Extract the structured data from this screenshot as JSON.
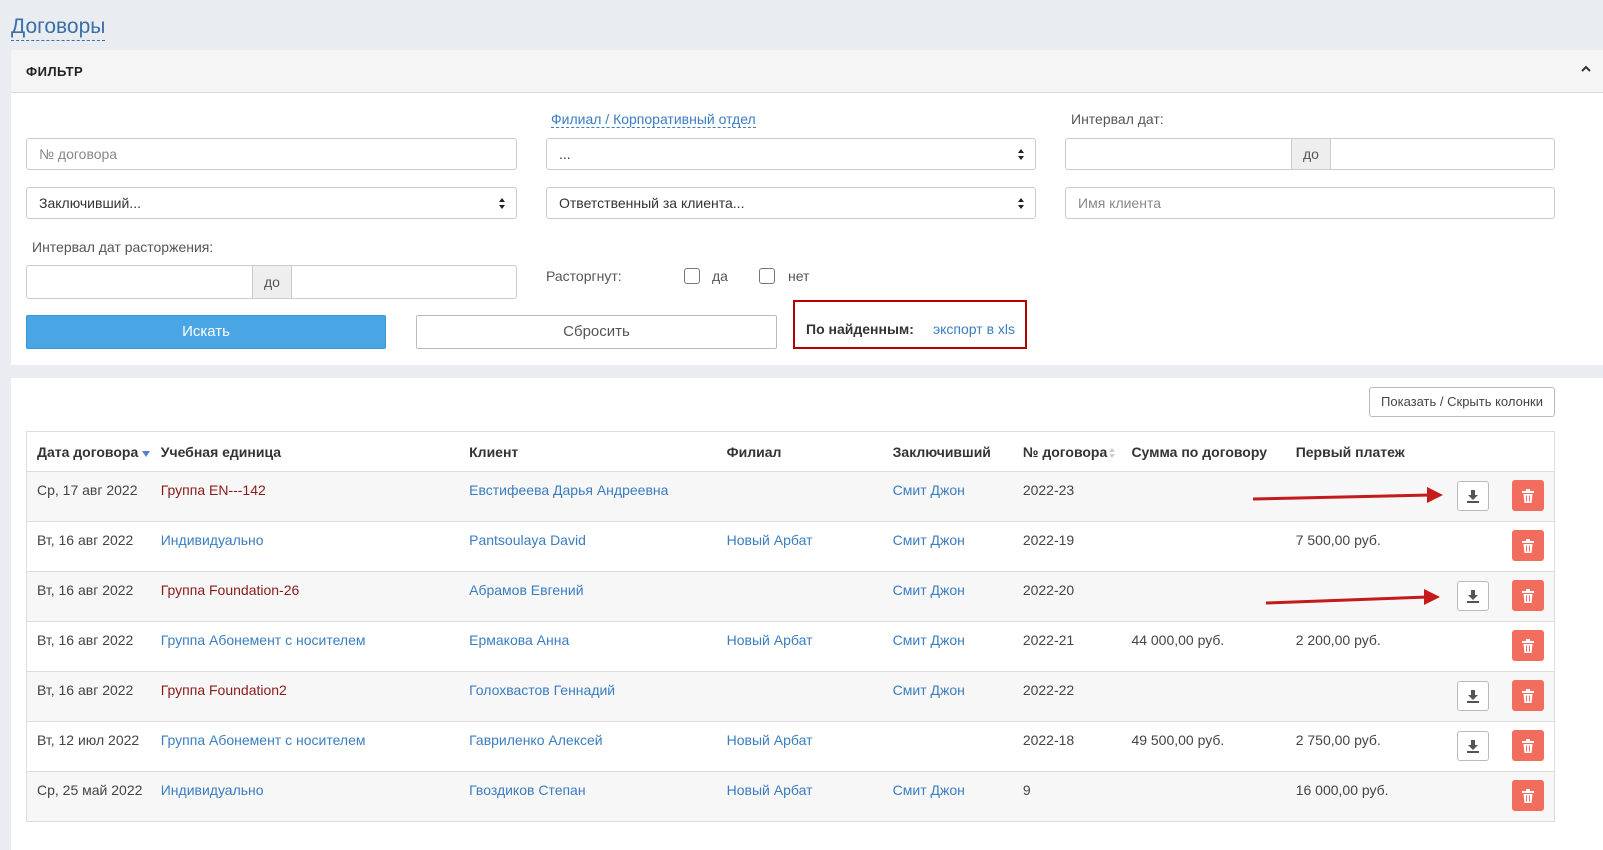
{
  "page_title": "Договоры",
  "filter": {
    "title": "ФИЛЬТР",
    "contract_no_placeholder": "№ договора",
    "branch_link": "Филиал / Корпоративный отдел",
    "branch_select_value": "...",
    "date_interval_label": "Интервал дат:",
    "date_to_label": "до",
    "concluded_select_value": "Заключивший...",
    "responsible_select_value": "Ответственный за клиента...",
    "client_name_placeholder": "Имя клиента",
    "termination_interval_label": "Интервал дат расторжения:",
    "termination_to_label": "до",
    "terminated_label": "Расторгнут:",
    "yes_label": "да",
    "no_label": "нет",
    "search_button": "Искать",
    "reset_button": "Сбросить",
    "export_label": "По найденным:",
    "export_link": "экспорт в xls"
  },
  "table": {
    "toggle_columns_button": "Показать / Скрыть колонки",
    "headers": [
      "Дата договора",
      "Учебная единица",
      "Клиент",
      "Филиал",
      "Заключивший",
      "№ договора",
      "Сумма по договору",
      "Первый платеж"
    ],
    "rows": [
      {
        "date": "Ср, 17 авг 2022",
        "unit": "Группа EN---142",
        "client": "Евстифеева Дарья Андреевна",
        "branch": "",
        "concluded": "Смит Джон",
        "number": "2022-23",
        "sum": "",
        "first_payment": "",
        "download": true
      },
      {
        "date": "Вт, 16 авг 2022",
        "unit": "Индивидуально",
        "client": "Pantsoulaya David",
        "branch": "Новый Арбат",
        "concluded": "Смит Джон",
        "number": "2022-19",
        "sum": "",
        "first_payment": "7 500,00 руб.",
        "download": false
      },
      {
        "date": "Вт, 16 авг 2022",
        "unit": "Группа Foundation-26",
        "client": "Абрамов Евгений",
        "branch": "",
        "concluded": "Смит Джон",
        "number": "2022-20",
        "sum": "",
        "first_payment": "",
        "download": true
      },
      {
        "date": "Вт, 16 авг 2022",
        "unit": "Группа Абонемент с носителем",
        "client": "Ермакова Анна",
        "branch": "Новый Арбат",
        "concluded": "Смит Джон",
        "number": "2022-21",
        "sum": "44 000,00 руб.",
        "first_payment": "2 200,00 руб.",
        "download": false
      },
      {
        "date": "Вт, 16 авг 2022",
        "unit": "Группа Foundation2",
        "client": "Голохвастов Геннадий",
        "branch": "",
        "concluded": "Смит Джон",
        "number": "2022-22",
        "sum": "",
        "first_payment": "",
        "download": true
      },
      {
        "date": "Вт, 12 июл 2022",
        "unit": "Группа Абонемент с носителем",
        "client": "Гавриленко Алексей",
        "branch": "Новый Арбат",
        "concluded": "",
        "number": "2022-18",
        "sum": "49 500,00 руб.",
        "first_payment": "2 750,00 руб.",
        "download": true
      },
      {
        "date": "Ср, 25 май 2022",
        "unit": "Индивидуально",
        "client": "Гвоздиков Степан",
        "branch": "Новый Арбат",
        "concluded": "Смит Джон",
        "number": "9",
        "sum": "",
        "first_payment": "16 000,00 руб.",
        "download": false
      }
    ]
  },
  "colors": {
    "link": "#3a7dc0",
    "group_link": "#8b1a1a",
    "primary_button": "#4aa5e5",
    "delete_button": "#f26d5e",
    "highlight": "#b30000"
  }
}
